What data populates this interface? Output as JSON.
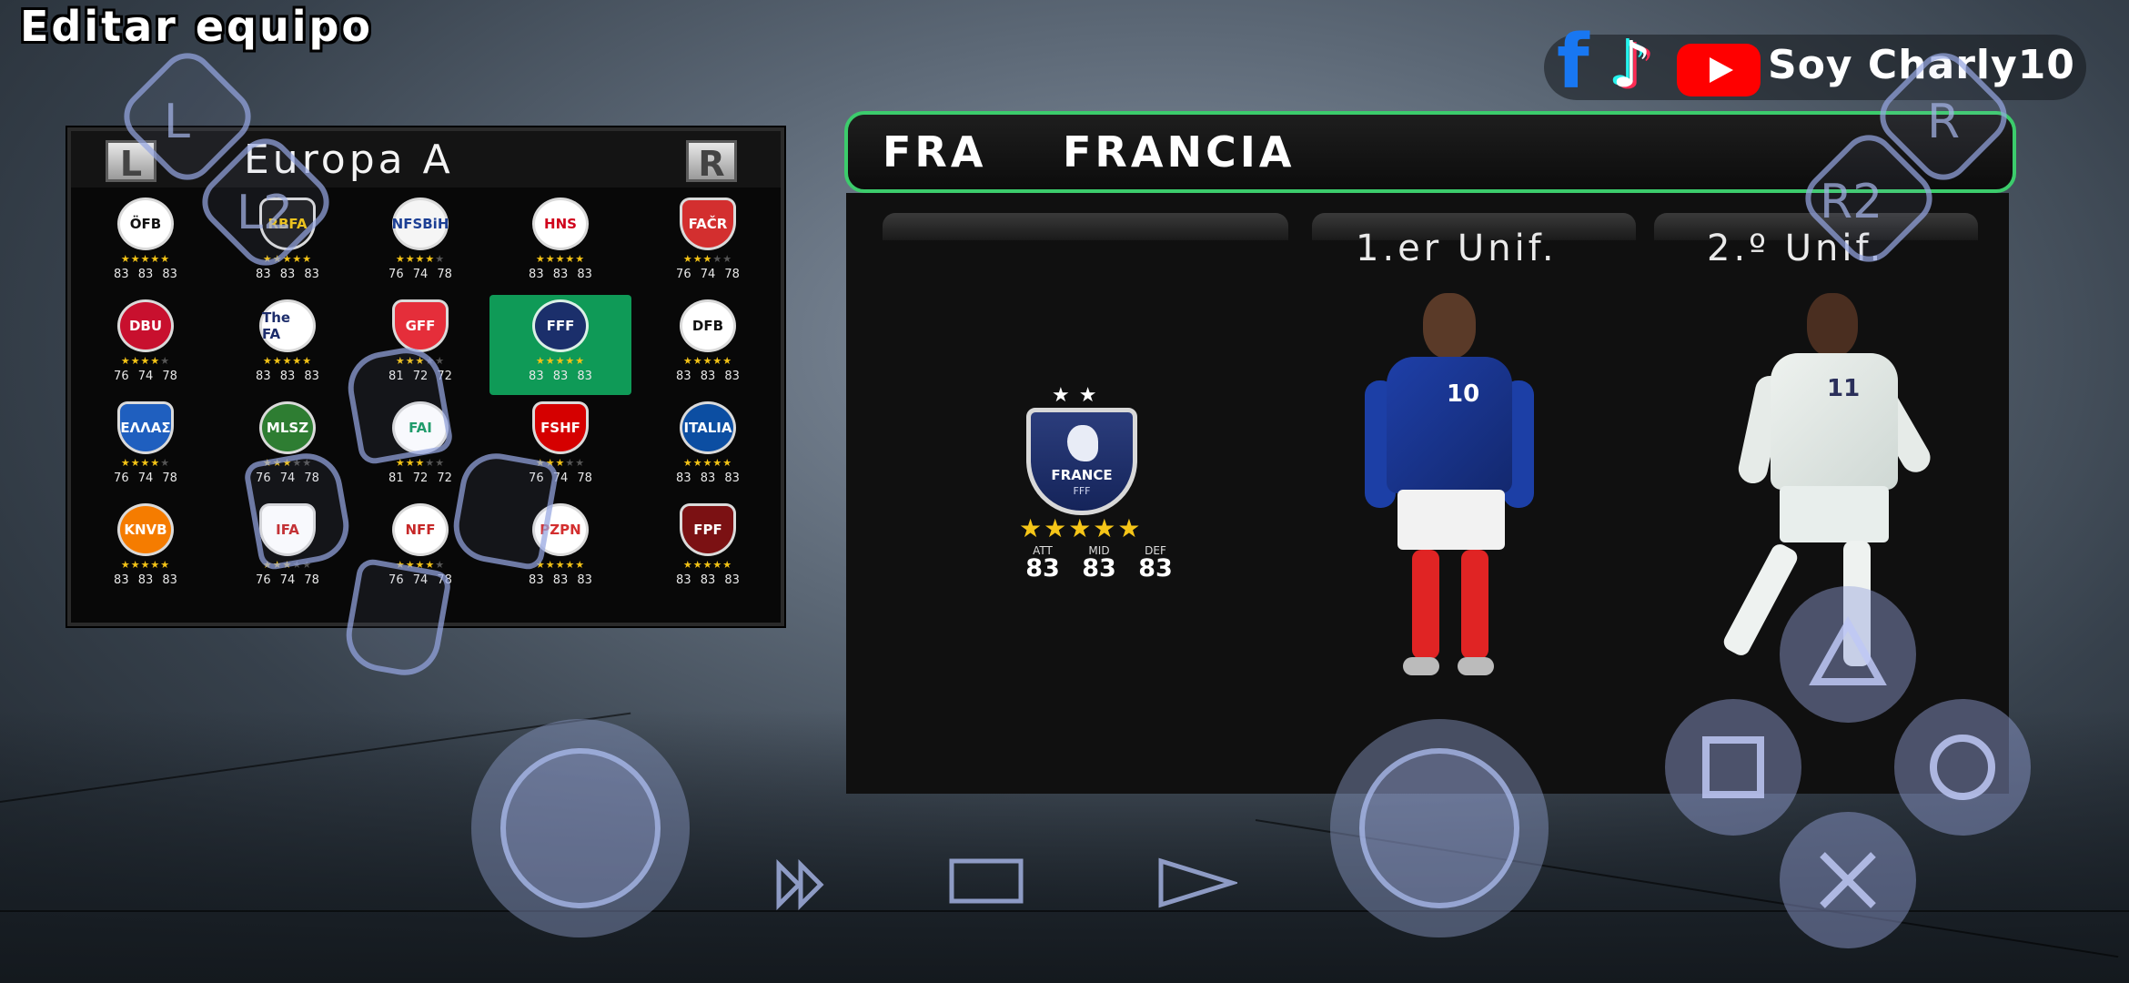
{
  "screen_title": "Editar equipo",
  "social": {
    "channel": "Soy Charly10",
    "icons": [
      "facebook-icon",
      "tiktok-icon",
      "youtube-icon"
    ]
  },
  "team_select": {
    "left_button": "L",
    "right_button": "R",
    "region": "Europa A",
    "teams": [
      {
        "crest_text": "ÖFB",
        "bg": "#ffffff",
        "fg": "#111111",
        "stars": 5,
        "ratings": "83 83 83"
      },
      {
        "crest_text": "RBFA",
        "bg": "#1a1a1a",
        "fg": "#f1c40f",
        "stars": 5,
        "ratings": "83 83 83"
      },
      {
        "crest_text": "NFSBiH",
        "bg": "#f5f5f5",
        "fg": "#1c3f94",
        "stars": 4,
        "ratings": "76 74 78"
      },
      {
        "crest_text": "HNS",
        "bg": "#ffffff",
        "fg": "#d0021b",
        "stars": 5,
        "ratings": "83 83 83"
      },
      {
        "crest_text": "FAČR",
        "bg": "#d32f2f",
        "fg": "#ffffff",
        "stars": 3,
        "ratings": "76 74 78"
      },
      {
        "crest_text": "DBU",
        "bg": "#c8102e",
        "fg": "#ffffff",
        "stars": 4,
        "ratings": "76 74 78"
      },
      {
        "crest_text": "The FA",
        "bg": "#ffffff",
        "fg": "#1d2d6b",
        "stars": 5,
        "ratings": "83 83 83"
      },
      {
        "crest_text": "GFF",
        "bg": "#e52e3a",
        "fg": "#ffffff",
        "stars": 3,
        "ratings": "81 72 72"
      },
      {
        "crest_text": "FFF",
        "bg": "#1b2f6b",
        "fg": "#ffffff",
        "stars": 5,
        "ratings": "83 83 83"
      },
      {
        "crest_text": "DFB",
        "bg": "#ffffff",
        "fg": "#111111",
        "stars": 5,
        "ratings": "83 83 83"
      },
      {
        "crest_text": "ΕΛΛΑΣ",
        "bg": "#1f5fbf",
        "fg": "#ffffff",
        "stars": 4,
        "ratings": "76 74 78"
      },
      {
        "crest_text": "MLSZ",
        "bg": "#2e7d32",
        "fg": "#ffffff",
        "stars": 3,
        "ratings": "76 74 78"
      },
      {
        "crest_text": "FAI",
        "bg": "#ffffff",
        "fg": "#169b62",
        "stars": 3,
        "ratings": "81 72 72"
      },
      {
        "crest_text": "FSHF",
        "bg": "#d50000",
        "fg": "#ffffff",
        "stars": 3,
        "ratings": "76 74 78"
      },
      {
        "crest_text": "ITALIA",
        "bg": "#0c4ea2",
        "fg": "#ffffff",
        "stars": 5,
        "ratings": "83 83 83"
      },
      {
        "crest_text": "KNVB",
        "bg": "#f57c00",
        "fg": "#ffffff",
        "stars": 5,
        "ratings": "83 83 83"
      },
      {
        "crest_text": "IFA",
        "bg": "#ffffff",
        "fg": "#c62828",
        "stars": 3,
        "ratings": "76 74 78"
      },
      {
        "crest_text": "NFF",
        "bg": "#ffffff",
        "fg": "#c62828",
        "stars": 4,
        "ratings": "76 74 78"
      },
      {
        "crest_text": "PZPN",
        "bg": "#ffffff",
        "fg": "#d32f2f",
        "stars": 5,
        "ratings": "83 83 83"
      },
      {
        "crest_text": "FPF",
        "bg": "#7b1113",
        "fg": "#ffffff",
        "stars": 5,
        "ratings": "83 83 83"
      }
    ]
  },
  "team_detail": {
    "code": "FRA",
    "name": "FRANCIA",
    "crest_name": "FRANCE",
    "crest_sub": "FFF",
    "crest_stars": "★★",
    "rating_stars": "★★★★★",
    "stats": [
      {
        "label": "ATT",
        "value": "83"
      },
      {
        "label": "MID",
        "value": "83"
      },
      {
        "label": "DEF",
        "value": "83"
      }
    ],
    "kit1_label": "1.er Unif.",
    "kit2_label": "2.º Unif.",
    "kit1_number": "10",
    "kit2_number": "11"
  },
  "controller": {
    "l": "L",
    "l2": "L2",
    "r": "R",
    "r2": "R2",
    "colors": {
      "overlay": "#96a5e1",
      "selected": "#0f9a57",
      "frame": "#3ccc6c"
    }
  }
}
